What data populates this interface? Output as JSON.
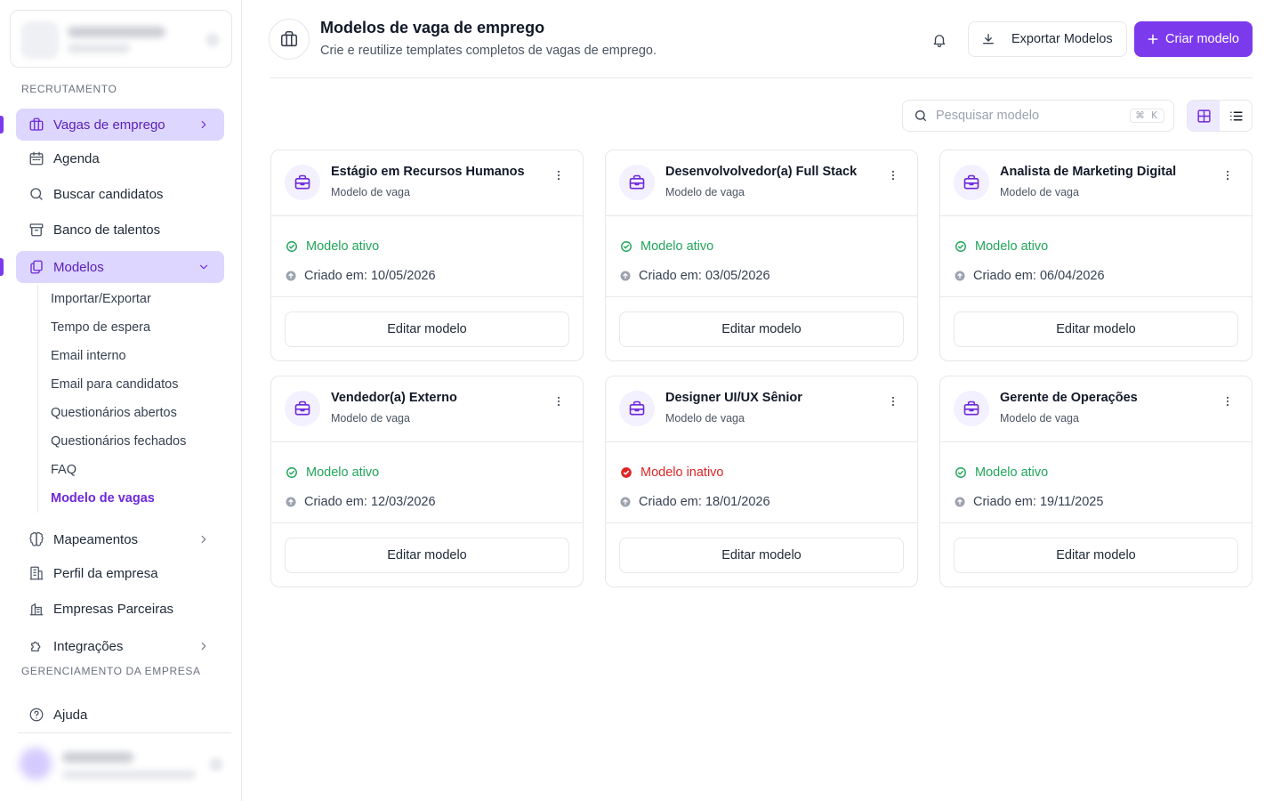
{
  "sidebar": {
    "section_recruitment": "RECRUTAMENTO",
    "section_company": "GERENCIAMENTO DA EMPRESA",
    "items": [
      {
        "label": "Vagas de emprego"
      },
      {
        "label": "Agenda"
      },
      {
        "label": "Buscar candidatos"
      },
      {
        "label": "Banco de talentos"
      },
      {
        "label": "Modelos"
      },
      {
        "label": "Mapeamentos"
      },
      {
        "label": "Perfil da empresa"
      },
      {
        "label": "Empresas Parceiras"
      },
      {
        "label": "Integrações"
      },
      {
        "label": "Ajuda"
      }
    ],
    "subitems": [
      {
        "label": "Importar/Exportar"
      },
      {
        "label": "Tempo de espera"
      },
      {
        "label": "Email interno"
      },
      {
        "label": "Email para candidatos"
      },
      {
        "label": "Questionários abertos"
      },
      {
        "label": "Questionários fechados"
      },
      {
        "label": "FAQ"
      },
      {
        "label": "Modelo de vagas"
      }
    ]
  },
  "header": {
    "title": "Modelos de vaga de emprego",
    "subtitle": "Crie e reutilize templates completos de vagas de emprego.",
    "export_label": "Exportar Modelos",
    "create_label": "Criar modelo"
  },
  "toolbar": {
    "search_placeholder": "Pesquisar modelo",
    "shortcut": "⌘ K"
  },
  "cards": [
    {
      "title": "Estágio em Recursos Humanos",
      "subtitle": "Modelo de vaga",
      "status": "Modelo ativo",
      "created": "Criado em: 10/05/2026",
      "edit": "Editar modelo"
    },
    {
      "title": "Desenvolvolvedor(a) Full Stack",
      "subtitle": "Modelo de vaga",
      "status": "Modelo ativo",
      "created": "Criado em: 03/05/2026",
      "edit": "Editar modelo"
    },
    {
      "title": "Analista de Marketing Digital",
      "subtitle": "Modelo de vaga",
      "status": "Modelo ativo",
      "created": "Criado em: 06/04/2026",
      "edit": "Editar modelo"
    },
    {
      "title": "Vendedor(a) Externo",
      "subtitle": "Modelo de vaga",
      "status": "Modelo ativo",
      "created": "Criado em: 12/03/2026",
      "edit": "Editar modelo"
    },
    {
      "title": "Designer UI/UX Sênior",
      "subtitle": "Modelo de vaga",
      "status": "Modelo inativo",
      "created": "Criado em: 18/01/2026",
      "edit": "Editar modelo"
    },
    {
      "title": "Gerente de Operações",
      "subtitle": "Modelo de vaga",
      "status": "Modelo ativo",
      "created": "Criado em: 19/11/2025",
      "edit": "Editar modelo"
    }
  ],
  "colors": {
    "accent": "#7c3aed",
    "active_bg": "#ddd6fe",
    "status_active": "#22a55b",
    "status_inactive": "#dc2626"
  }
}
